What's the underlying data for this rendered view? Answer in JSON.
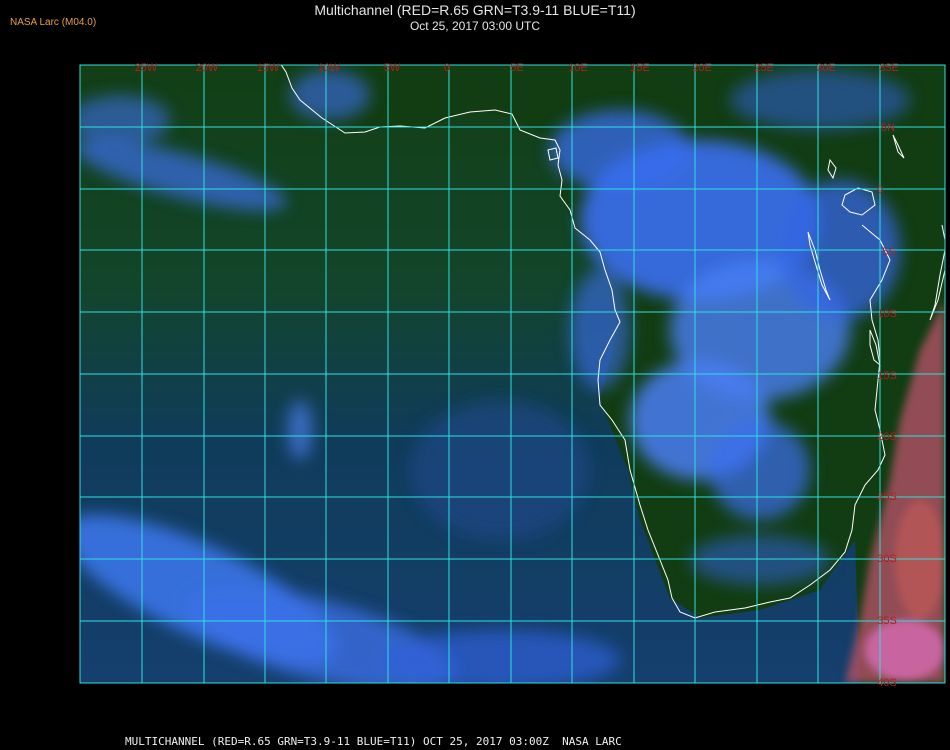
{
  "header": {
    "agency": "NASA Larc (M04.0)",
    "title": "Multichannel (RED=R.65 GRN=T3.9-11 BLUE=T11)",
    "subtitle": "Oct 25, 2017 03:00 UTC"
  },
  "footer": {
    "caption": "MULTICHANNEL (RED=R.65 GRN=T3.9-11 BLUE=T11) OCT 25, 2017 03:00Z  NASA LARC"
  },
  "grid": {
    "lon_labels": [
      "25W",
      "20W",
      "15W",
      "10W",
      "5W",
      "0",
      "5E",
      "10E",
      "15E",
      "20E",
      "25E",
      "30E",
      "35E"
    ],
    "lat_labels": [
      "5N",
      "0",
      "5S",
      "10S",
      "15S",
      "20S",
      "25S",
      "30S",
      "35S",
      "40S"
    ]
  },
  "colors": {
    "ocean": "#123c5a",
    "cloud": "#3a6cf0",
    "land": "#0f3a10",
    "gridline": "#2ee0e0",
    "coast": "#ffffff",
    "gridlabel": "#b81c1c",
    "cold_cloud": "#d06060"
  }
}
